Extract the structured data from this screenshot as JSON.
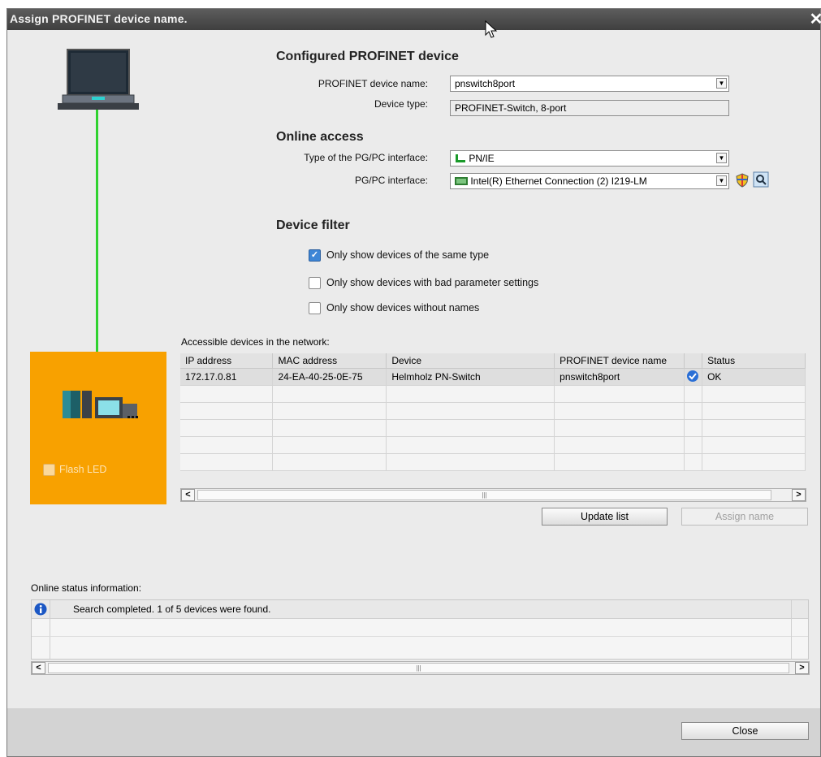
{
  "window": {
    "title": "Assign PROFINET device name.",
    "close_label": "✕"
  },
  "configured": {
    "heading": "Configured PROFINET device",
    "device_name_label": "PROFINET device name:",
    "device_name_value": "pnswitch8port",
    "device_type_label": "Device type:",
    "device_type_value": "PROFINET-Switch, 8-port"
  },
  "online_access": {
    "heading": "Online access",
    "interface_type_label": "Type of the PG/PC interface:",
    "interface_type_value": "PN/IE",
    "interface_label": "PG/PC interface:",
    "interface_value": "Intel(R) Ethernet Connection (2) I219-LM"
  },
  "filter": {
    "heading": "Device filter",
    "options": [
      {
        "label": "Only show devices of the same type",
        "checked": true
      },
      {
        "label": "Only show devices with bad parameter settings",
        "checked": false
      },
      {
        "label": "Only show devices without names",
        "checked": false
      }
    ]
  },
  "flash_led": {
    "label": "Flash LED",
    "checked": false,
    "enabled": false
  },
  "devices": {
    "caption": "Accessible devices in the network:",
    "columns": [
      "IP address",
      "MAC address",
      "Device",
      "PROFINET device name",
      "",
      "Status"
    ],
    "rows": [
      {
        "ip": "172.17.0.81",
        "mac": "24-EA-40-25-0E-75",
        "device": "Helmholz PN-Switch",
        "name": "pnswitch8port",
        "status": "OK"
      }
    ],
    "empty_rows": 5
  },
  "buttons": {
    "update": "Update list",
    "assign": "Assign name",
    "close": "Close"
  },
  "status": {
    "caption": "Online status information:",
    "messages": [
      {
        "icon": "info-icon",
        "text": "Search completed. 1 of 5 devices were found."
      }
    ]
  },
  "colors": {
    "accent_orange": "#f8a100",
    "link_green": "#2fd22f",
    "title_bar": "#4a4a4a",
    "check_blue": "#3d86d6"
  }
}
